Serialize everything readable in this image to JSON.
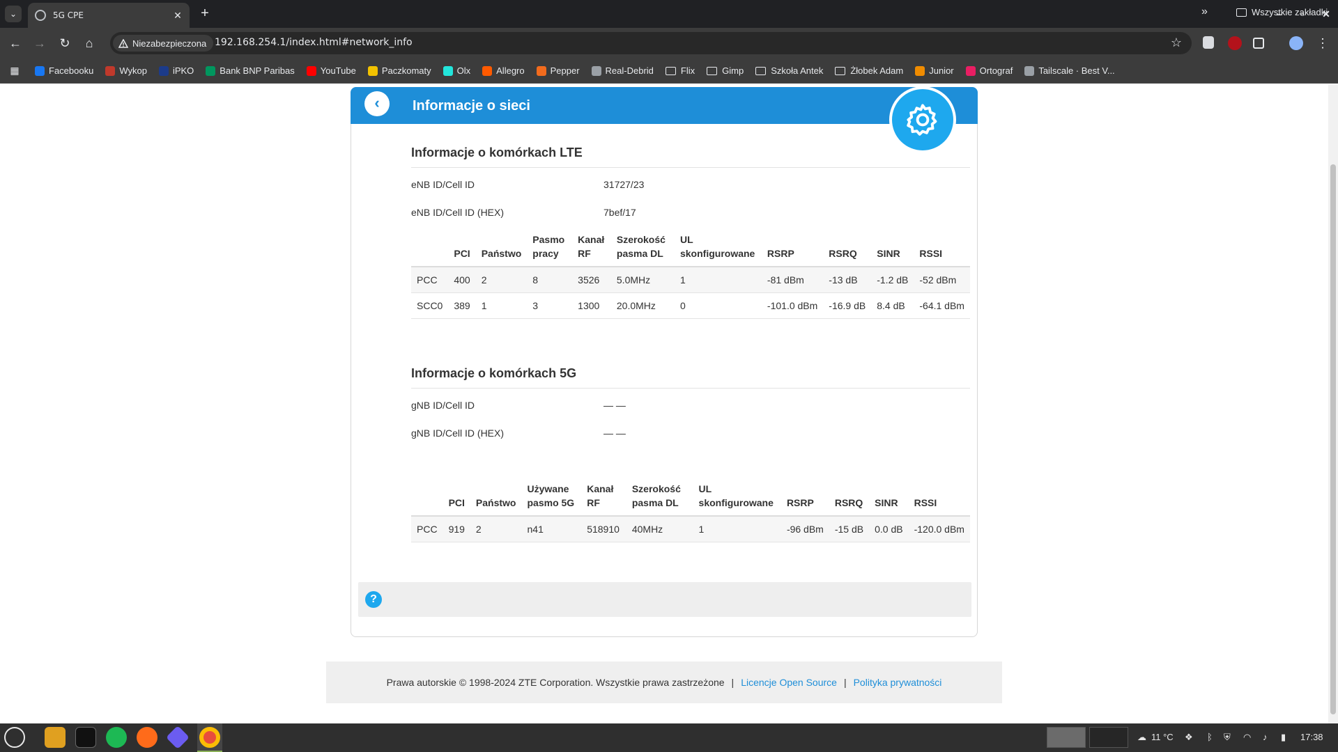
{
  "browser": {
    "tab_title": "5G CPE",
    "tab_close": "✕",
    "new_tab": "+",
    "security_label": "Niezabezpieczona",
    "url": "192.168.254.1/index.html#network_info",
    "bookmarks": [
      {
        "label": "Facebooku",
        "color": "#1877f2",
        "icon": "facebook-icon"
      },
      {
        "label": "Wykop",
        "color": "#c0392b",
        "icon": "wykop-icon"
      },
      {
        "label": "iPKO",
        "color": "#1c3b8a",
        "icon": "pko-icon"
      },
      {
        "label": "Bank BNP Paribas",
        "color": "#00965e",
        "icon": "bnp-icon"
      },
      {
        "label": "YouTube",
        "color": "#ff0000",
        "icon": "youtube-icon"
      },
      {
        "label": "Paczkomaty",
        "color": "#f2c200",
        "icon": "paczkomaty-icon"
      },
      {
        "label": "Olx",
        "color": "#23e5db",
        "icon": "olx-icon"
      },
      {
        "label": "Allegro",
        "color": "#ff5a00",
        "icon": "allegro-icon"
      },
      {
        "label": "Pepper",
        "color": "#f26b1d",
        "icon": "pepper-icon"
      },
      {
        "label": "Real-Debrid",
        "color": "#9aa0a6",
        "icon": "realdebrid-icon"
      },
      {
        "label": "Flix",
        "folder": true
      },
      {
        "label": "Gimp",
        "folder": true
      },
      {
        "label": "Szkoła Antek",
        "folder": true
      },
      {
        "label": "Żłobek Adam",
        "folder": true
      },
      {
        "label": "Junior",
        "color": "#f08c00",
        "icon": "junior-icon"
      },
      {
        "label": "Ortograf",
        "color": "#e91e63",
        "icon": "ortograf-icon"
      },
      {
        "label": "Tailscale · Best V...",
        "color": "#9aa0a6",
        "icon": "tailscale-icon"
      }
    ],
    "more_bookmarks": "»",
    "all_bookmarks": "Wszystkie zakładki"
  },
  "page": {
    "header_title": "Informacje o sieci",
    "lte": {
      "title": "Informacje o komórkach LTE",
      "kv": [
        {
          "label": "eNB ID/Cell ID",
          "value": "31727/23"
        },
        {
          "label": "eNB ID/Cell ID (HEX)",
          "value": "7bef/17"
        }
      ],
      "columns": [
        "",
        "PCI",
        "Państwo",
        "Pasmo pracy",
        "Kanał RF",
        "Szerokość pasma DL",
        "UL skonfigurowane",
        "RSRP",
        "RSRQ",
        "SINR",
        "RSSI"
      ],
      "rows": [
        [
          "PCC",
          "400",
          "2",
          "8",
          "3526",
          "5.0MHz",
          "1",
          "-81 dBm",
          "-13 dB",
          "-1.2 dB",
          "-52 dBm"
        ],
        [
          "SCC0",
          "389",
          "1",
          "3",
          "1300",
          "20.0MHz",
          "0",
          "-101.0 dBm",
          "-16.9 dB",
          "8.4 dB",
          "-64.1 dBm"
        ]
      ]
    },
    "nr": {
      "title": "Informacje o komórkach 5G",
      "kv": [
        {
          "label": "gNB ID/Cell ID",
          "value": "— —"
        },
        {
          "label": "gNB ID/Cell ID (HEX)",
          "value": "— —"
        }
      ],
      "columns": [
        "",
        "PCI",
        "Państwo",
        "Używane pasmo 5G",
        "Kanał RF",
        "Szerokość pasma DL",
        "UL skonfigurowane",
        "RSRP",
        "RSRQ",
        "SINR",
        "RSSI"
      ],
      "rows": [
        [
          "PCC",
          "919",
          "2",
          "n41",
          "518910",
          "40MHz",
          "1",
          "-96 dBm",
          "-15 dB",
          "0.0 dB",
          "-120.0 dBm"
        ]
      ]
    },
    "help_symbol": "?",
    "footer": {
      "copyright": "Prawa autorskie © 1998-2024 ZTE Corporation. Wszystkie prawa zastrzeżone",
      "separator": "|",
      "license_link": "Licencje Open Source",
      "privacy_link": "Polityka prywatności"
    }
  },
  "taskbar": {
    "weather": "11 °C",
    "clock": "17:38"
  },
  "colors": {
    "accent": "#1e8ed8",
    "gear": "#1ea8ee",
    "chrome_dark": "#202124",
    "chrome_toolbar": "#3c3c3c"
  }
}
